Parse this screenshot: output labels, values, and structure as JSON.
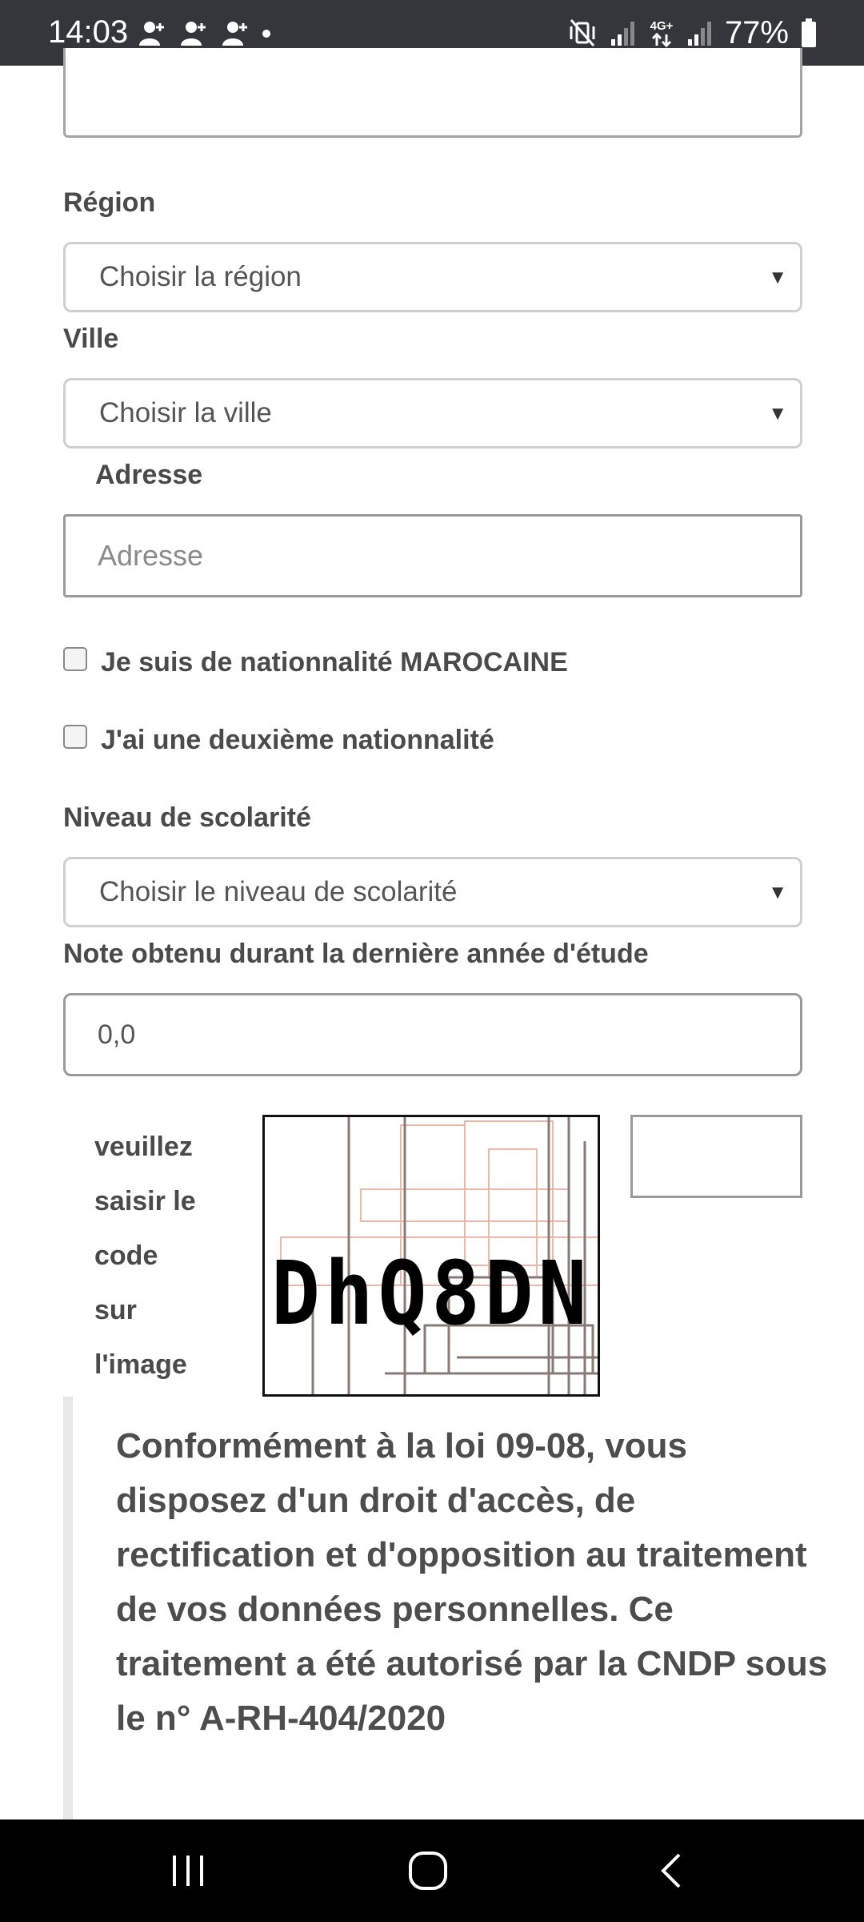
{
  "status_bar": {
    "time": "14:03",
    "notification_icons": [
      "person-add-icon",
      "person-add-icon",
      "person-add-icon",
      "dot-icon"
    ],
    "network_label": "4G+",
    "battery": "77%"
  },
  "form": {
    "region": {
      "label": "Région",
      "selected": "Choisir la région"
    },
    "ville": {
      "label": "Ville",
      "selected": "Choisir la ville"
    },
    "adresse": {
      "label": "Adresse",
      "placeholder": "Adresse"
    },
    "checkbox_marocaine": {
      "label": "Je suis de nationnalité MAROCAINE",
      "checked": false
    },
    "checkbox_deuxieme": {
      "label": "J'ai une deuxième nationnalité",
      "checked": false
    },
    "niveau": {
      "label": "Niveau de scolarité",
      "selected": "Choisir le niveau de scolarité"
    },
    "note": {
      "label": "Note obtenu durant la dernière année d'étude",
      "value": "0,0"
    },
    "captcha": {
      "label_lines": [
        "veuillez",
        "saisir le",
        "code",
        "sur",
        "l'image"
      ],
      "code": "DhQ8DN",
      "value": ""
    }
  },
  "notice": {
    "text": "Conformément à la loi 09-08, vous disposez d'un droit d'accès, de rectification et d'opposition au traitement de vos données personnelles. Ce traitement a été autorisé par la CNDP sous le n° A-RH-404/2020"
  },
  "nav_bar": {
    "buttons": [
      "recents-icon",
      "home-icon",
      "back-icon"
    ]
  },
  "colors": {
    "status_bar_bg": "#34363b",
    "nav_bar_bg": "#000000",
    "text": "#4a4a4a",
    "notice_border": "#e8e8e8"
  }
}
